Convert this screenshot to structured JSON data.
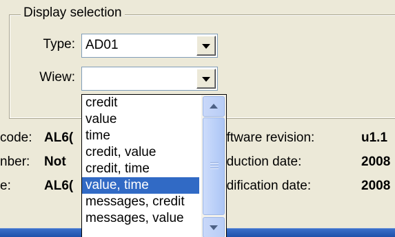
{
  "display_selection": {
    "legend": "Display selection",
    "type_label": "Type:",
    "type_value": "AD01",
    "view_label": "Wiew:",
    "view_value": ""
  },
  "info": {
    "left": [
      {
        "label": "code:",
        "value": "AL6("
      },
      {
        "label": "nber:",
        "value": "Not"
      },
      {
        "label": "e:",
        "value": "AL6("
      }
    ],
    "right": [
      {
        "label": "oftware revision:",
        "value": "u1.1"
      },
      {
        "label": "oduction date:",
        "value": "2008"
      },
      {
        "label": "odification date:",
        "value": "2008"
      }
    ]
  },
  "dropdown": {
    "items": [
      "credit",
      "value",
      "time",
      "credit, value",
      "credit, time",
      "value, time",
      "messages, credit",
      "messages, value"
    ],
    "selected_index": 5
  },
  "colors": {
    "window_bg": "#ece9d8",
    "selection": "#316ac5",
    "scrollbar": "#b8cdf6",
    "bottom_band": "#1c4fa8"
  },
  "icons": {
    "combo_button": "chevron-down-icon",
    "scroll_up": "scroll-up-icon",
    "scroll_down": "scroll-down-icon"
  }
}
